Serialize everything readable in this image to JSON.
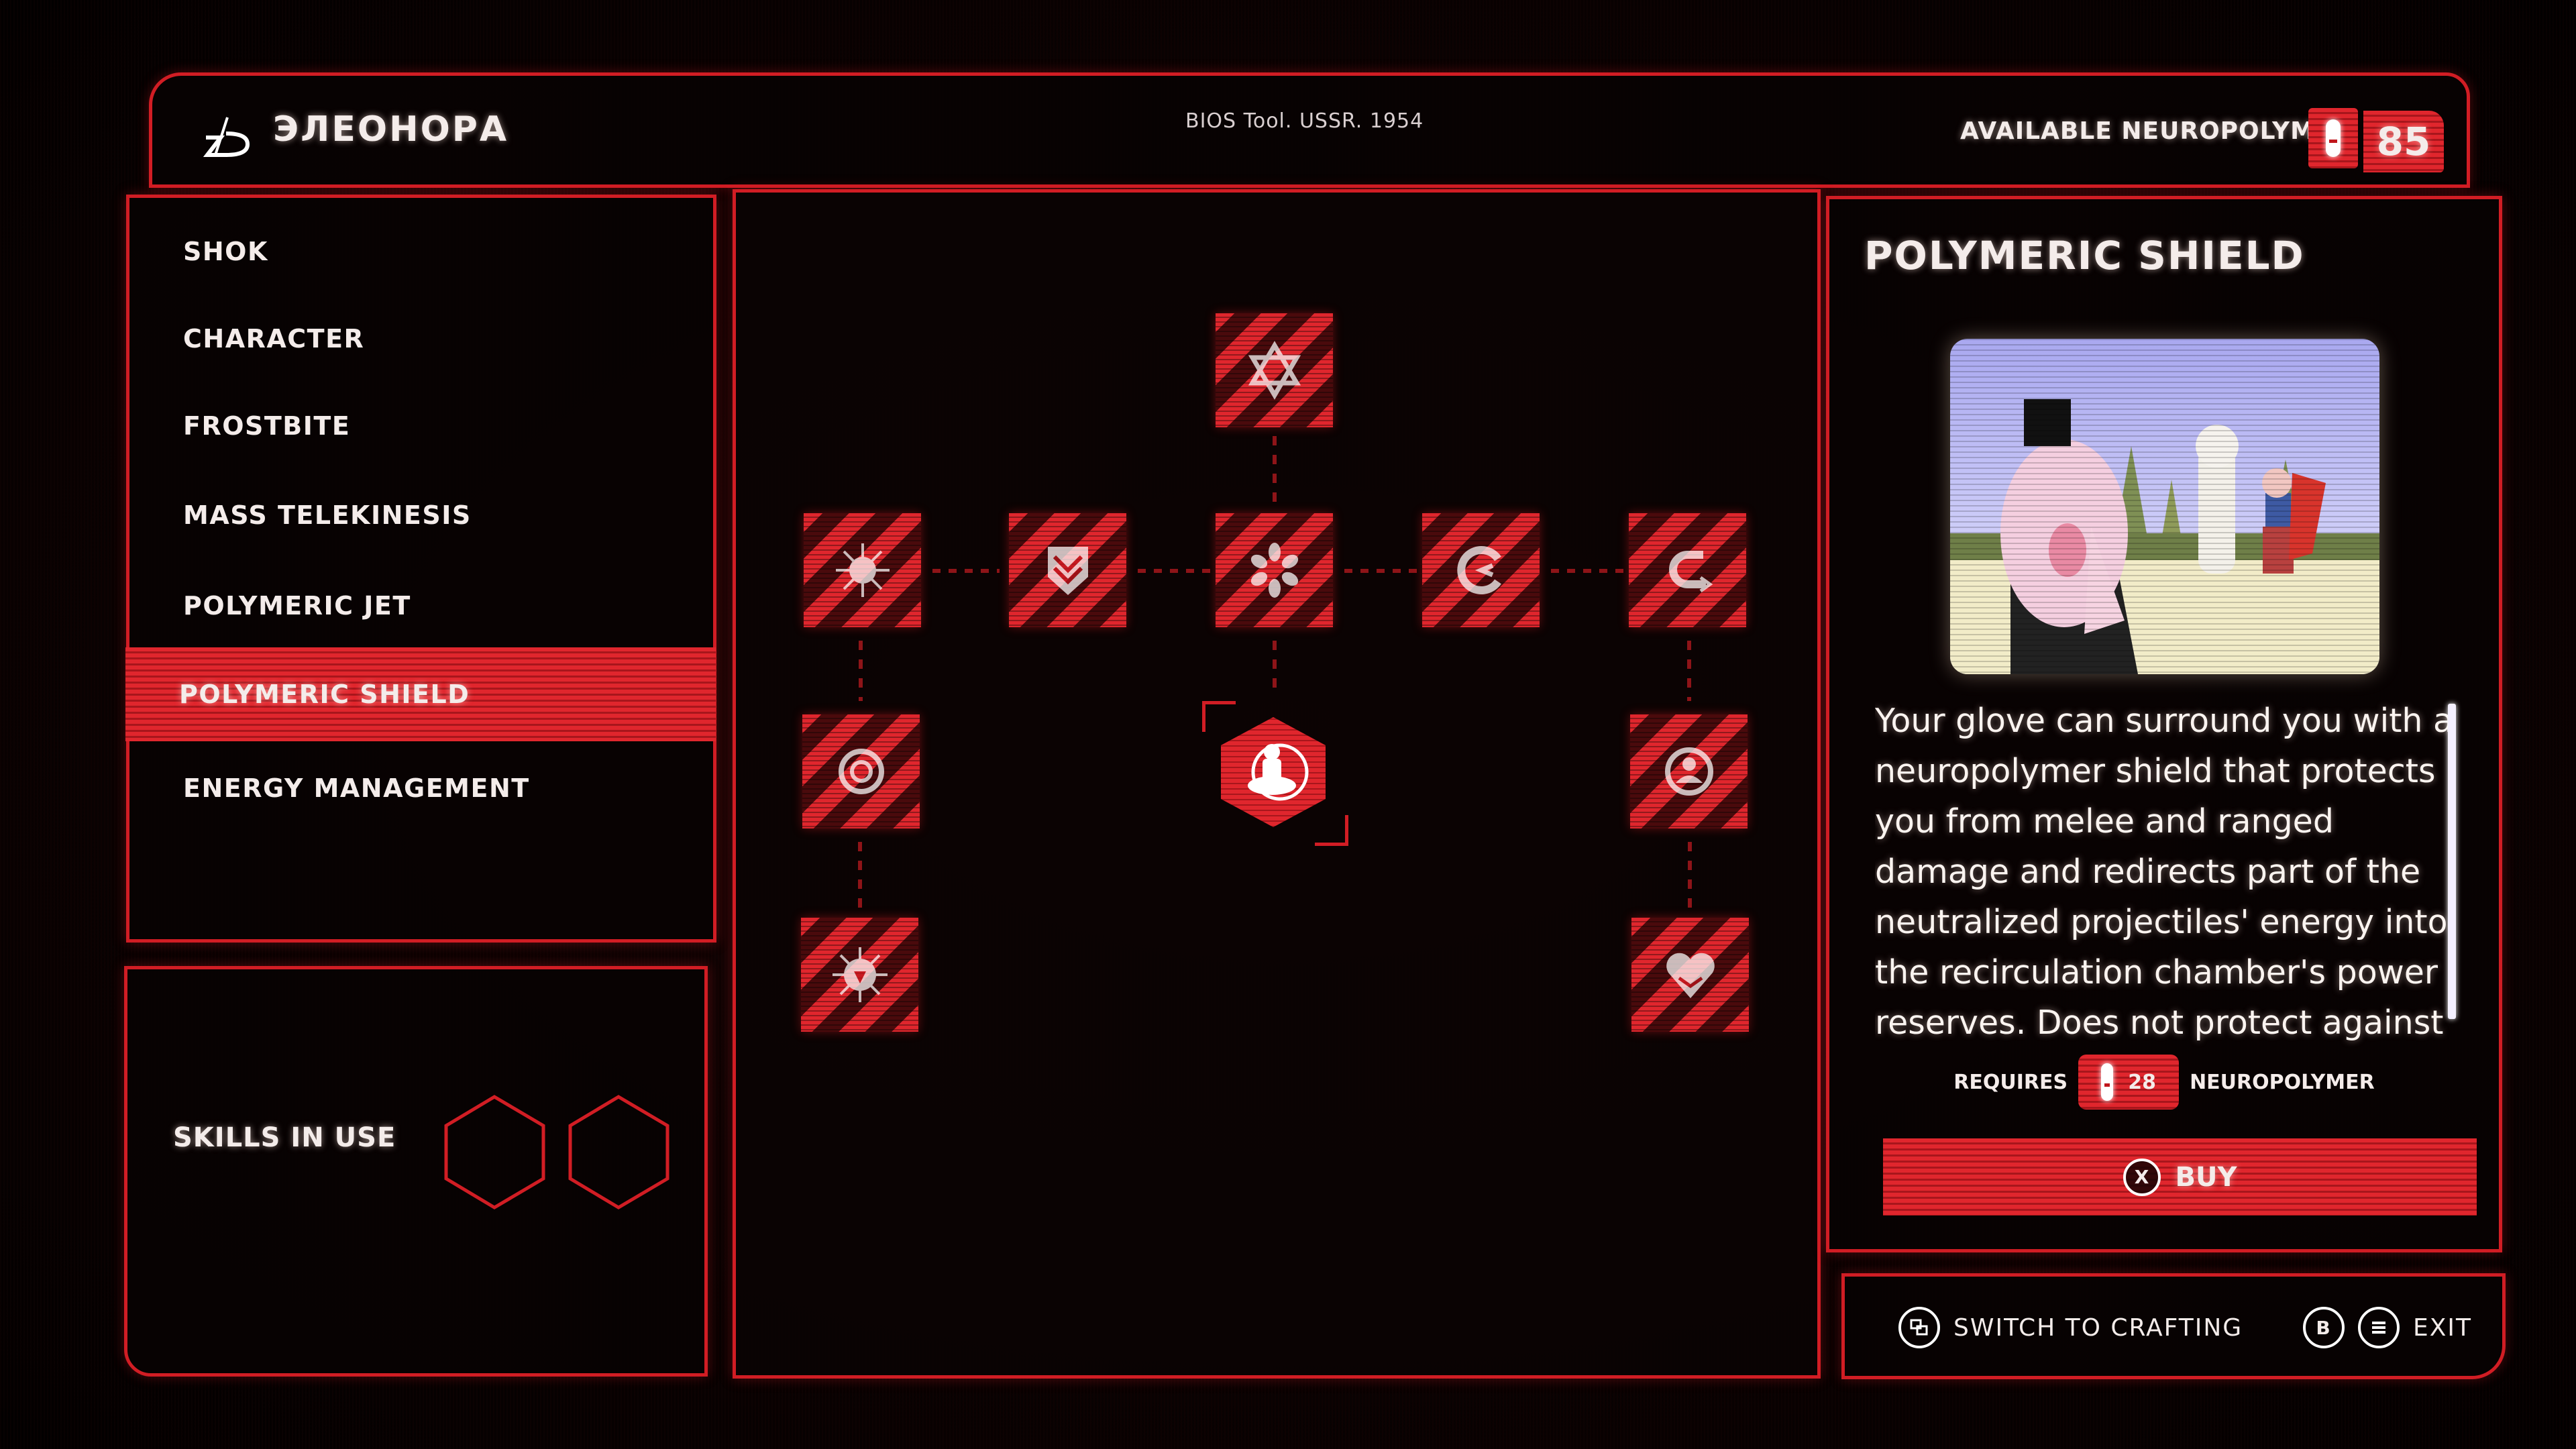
{
  "header": {
    "app_title": "ЭЛЕОНОРА",
    "subtitle": "BIOS Tool. USSR. 1954",
    "neuropolymer_label": "AVAILABLE NEUROPOLYMER",
    "neuropolymer_count": "85"
  },
  "menu": {
    "items": [
      {
        "label": "SHOK",
        "active": false
      },
      {
        "label": "CHARACTER",
        "active": false
      },
      {
        "label": "FROSTBITE",
        "active": false
      },
      {
        "label": "MASS TELEKINESIS",
        "active": false
      },
      {
        "label": "POLYMERIC JET",
        "active": false
      },
      {
        "label": "POLYMERIC SHIELD",
        "active": true
      },
      {
        "label": "ENERGY MANAGEMENT",
        "active": false
      }
    ]
  },
  "skills_in_use": {
    "label": "SKILLS IN USE",
    "slots": [
      "empty",
      "empty"
    ]
  },
  "tree": {
    "nodes": [
      {
        "id": "top",
        "icon": "star-of-david-icon",
        "state": "locked"
      },
      {
        "id": "r1c1",
        "icon": "sun-burst-icon",
        "state": "locked"
      },
      {
        "id": "r1c2",
        "icon": "shield-chevron-icon",
        "state": "locked"
      },
      {
        "id": "r1c3",
        "icon": "snowflake-icon",
        "state": "locked"
      },
      {
        "id": "r1c4",
        "icon": "recirculate-icon",
        "state": "locked"
      },
      {
        "id": "r1c5",
        "icon": "cycle-arrow-icon",
        "state": "locked"
      },
      {
        "id": "r2c1",
        "icon": "orbit-icon",
        "state": "locked"
      },
      {
        "id": "r2c3",
        "icon": "person-shield-icon",
        "state": "selected"
      },
      {
        "id": "r2c5",
        "icon": "guard-circle-icon",
        "state": "locked"
      },
      {
        "id": "r3c1",
        "icon": "spiked-burst-icon",
        "state": "locked"
      },
      {
        "id": "r3c5",
        "icon": "heart-icon",
        "state": "locked"
      }
    ]
  },
  "detail": {
    "title": "POLYMERIC SHIELD",
    "image_alt": "cartoon-illustration",
    "description": "Your glove can surround you with a neuropolymer shield that protects you from melee and ranged damage and redirects part of the neutralized projectiles' energy into the recirculation chamber's power reserves. Does not protect against",
    "requires_label": "REQUIRES",
    "requires_amount": "28",
    "requires_unit": "NEUROPOLYMER",
    "buy_key": "X",
    "buy_label": "BUY"
  },
  "hints": {
    "switch_label": "SWITCH TO CRAFTING",
    "back_key": "B",
    "exit_label": "EXIT"
  },
  "colors": {
    "accent": "#d11d24",
    "accent_bright": "#e0262d",
    "text": "#f4ecea",
    "background": "#0b0202"
  }
}
